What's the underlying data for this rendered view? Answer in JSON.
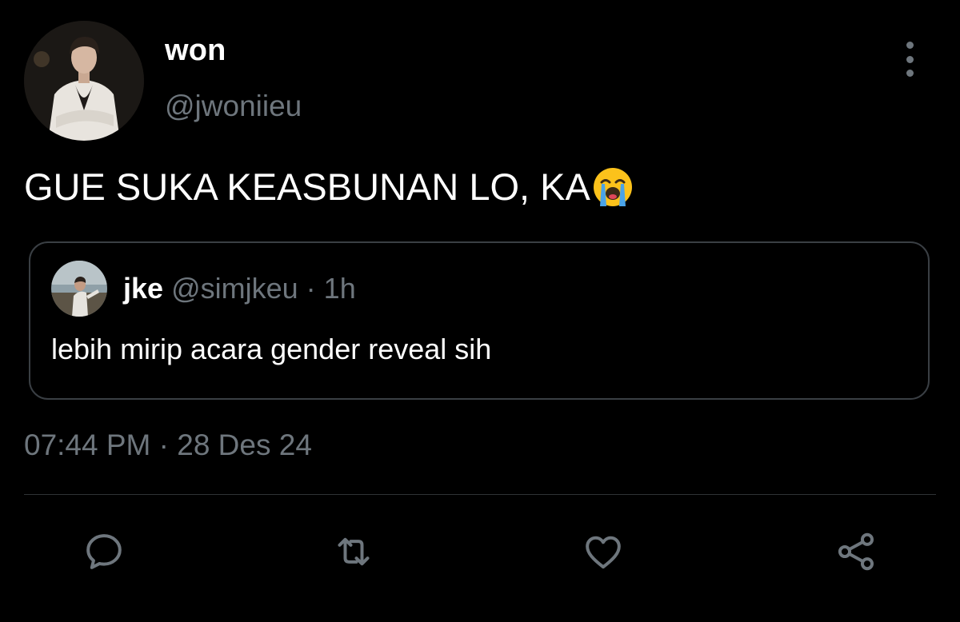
{
  "author": {
    "display_name": "won",
    "handle": "@jwoniieu"
  },
  "tweet": {
    "text": "GUE SUKA KEASBUNAN LO, KA",
    "emoji": "loudly-crying-face-emoji"
  },
  "quoted_tweet": {
    "display_name": "jke",
    "handle": "@simjkeu",
    "separator": "·",
    "time_ago": "1h",
    "text": "lebih mirip acara gender reveal sih"
  },
  "timestamp": "07:44 PM · 28 Des 24",
  "actions": [
    {
      "name": "reply",
      "icon": "reply-icon"
    },
    {
      "name": "retweet",
      "icon": "retweet-icon"
    },
    {
      "name": "like",
      "icon": "heart-icon"
    },
    {
      "name": "share",
      "icon": "share-icon"
    }
  ],
  "colors": {
    "background": "#000000",
    "primary_text": "#ffffff",
    "secondary_text": "#6e767d",
    "border": "#3a3f44",
    "icon": "#6e767d"
  }
}
